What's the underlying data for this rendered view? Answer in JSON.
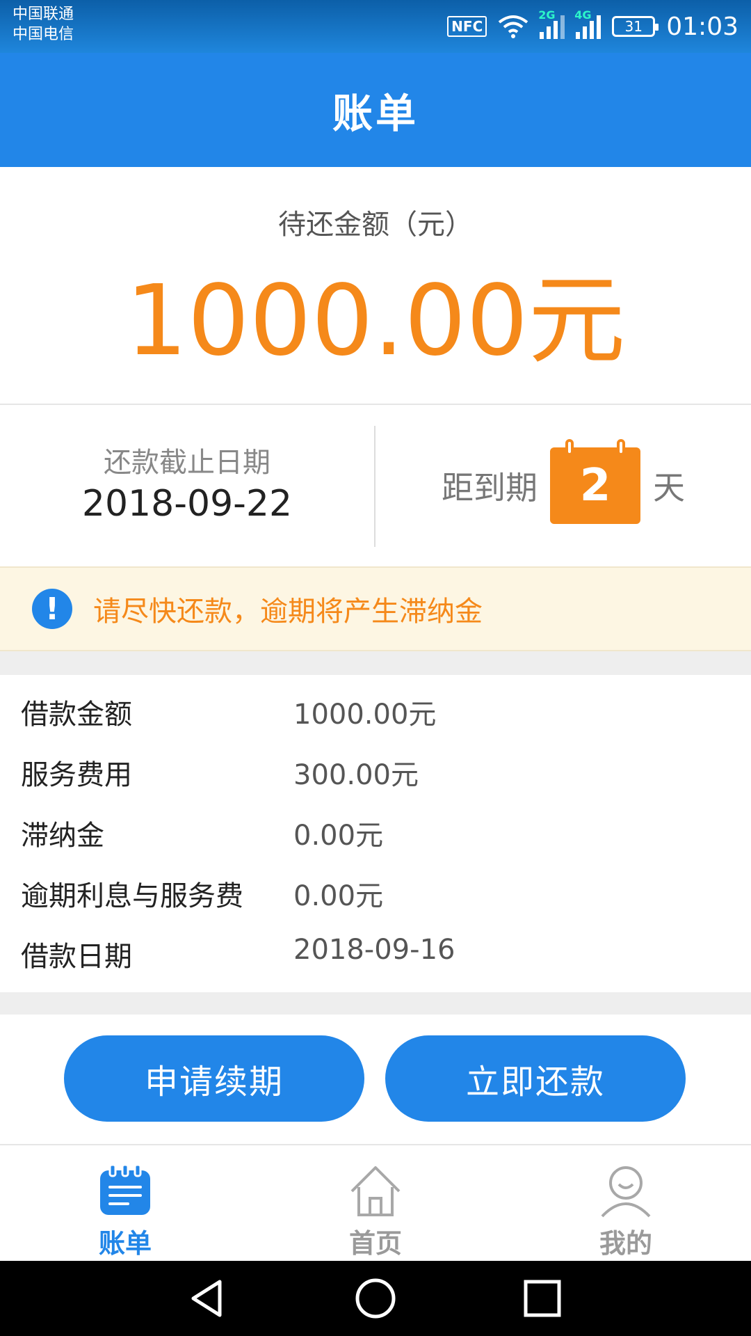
{
  "status_bar": {
    "carrier1": "中国联通",
    "carrier2": "中国电信",
    "nfc": "NFC",
    "sig1_tag": "2G",
    "sig2_tag": "4G",
    "battery": "31",
    "time": "01:03"
  },
  "header": {
    "title": "账单"
  },
  "amount": {
    "label": "待还金额（元）",
    "value": "1000.00元"
  },
  "due": {
    "label": "还款截止日期",
    "date": "2018-09-22",
    "countdown_label": "距到期",
    "days": "2",
    "unit": "天"
  },
  "notice": {
    "icon": "!",
    "text": "请尽快还款，逾期将产生滞纳金"
  },
  "details": [
    {
      "key": "借款金额",
      "value": "1000.00元"
    },
    {
      "key": "服务费用",
      "value": "300.00元"
    },
    {
      "key": "滞纳金",
      "value": "0.00元"
    },
    {
      "key": "逾期利息与服务费",
      "value": "0.00元"
    },
    {
      "key": "借款日期",
      "value": "2018-09-16"
    }
  ],
  "actions": {
    "renew": "申请续期",
    "repay": "立即还款"
  },
  "tabs": [
    {
      "label": "账单",
      "icon": "bill-icon",
      "active": true
    },
    {
      "label": "首页",
      "icon": "home-icon",
      "active": false
    },
    {
      "label": "我的",
      "icon": "user-icon",
      "active": false
    }
  ],
  "colors": {
    "primary": "#2286e8",
    "accent": "#f5891a",
    "notice_bg": "#fdf6e3"
  }
}
